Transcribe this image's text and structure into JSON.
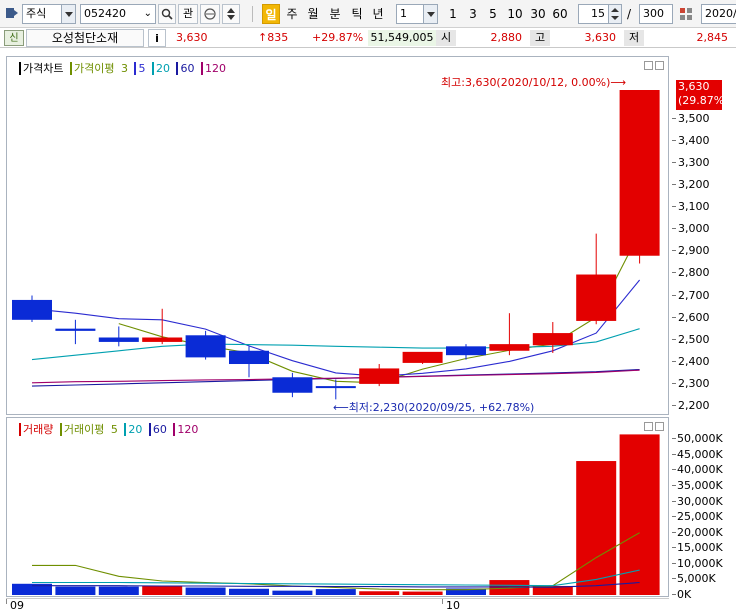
{
  "toolbar": {
    "market": "주식",
    "code": "052420",
    "btn_gwan": "관",
    "periods": [
      "일",
      "주",
      "월",
      "분",
      "틱",
      "년"
    ],
    "active_period": "일",
    "interval": "1",
    "quick_counts": [
      "1",
      "3",
      "5",
      "10",
      "30",
      "60"
    ],
    "count": "15",
    "separator": "/",
    "total": "300",
    "date": "2020/"
  },
  "info": {
    "badge": "신",
    "name": "오성첨단소재",
    "info_btn": "i",
    "price": "3,630",
    "change": "↑835",
    "change_pct": "+29.87%",
    "volume": "51,549,005",
    "open_label": "시",
    "open": "2,880",
    "high_label": "고",
    "high": "3,630",
    "low_label": "저",
    "low": "2,845"
  },
  "price_panel": {
    "legend_title": "가격차트",
    "legend_ma_label": "가격이평",
    "legend_ma": [
      "3",
      "5",
      "20",
      "60",
      "120"
    ],
    "max_annotation": "최고:3,630(2020/10/12, 0.00%)⟶",
    "min_annotation": "⟵최저:2,230(2020/09/25, +62.78%)",
    "current_price_tag": "3,630",
    "current_pct_tag": "(29.87%)"
  },
  "volume_panel": {
    "legend_title": "거래량",
    "legend_ma_label": "거래이평",
    "legend_ma": [
      "5",
      "20",
      "60",
      "120"
    ]
  },
  "x_axis": {
    "labels": [
      "09",
      "10"
    ]
  },
  "colors": {
    "up": "#e30000",
    "down": "#0a2bd6",
    "ma3": "#6f8f00",
    "ma5": "#2b2bd0",
    "ma20": "#00a0b0",
    "ma60": "#1a1aa0",
    "ma120": "#a0006a"
  },
  "chart_data": [
    {
      "type": "candlestick",
      "title": "가격차트",
      "ylim": [
        2200,
        3630
      ],
      "y_ticks": [
        "3,500",
        "3,400",
        "3,300",
        "3,200",
        "3,100",
        "3,000",
        "2,900",
        "2,800",
        "2,700",
        "2,600",
        "2,500",
        "2,400",
        "2,300",
        "2,200"
      ],
      "candles": [
        {
          "o": 2680,
          "h": 2700,
          "l": 2580,
          "c": 2590
        },
        {
          "o": 2550,
          "h": 2590,
          "l": 2480,
          "c": 2540
        },
        {
          "o": 2510,
          "h": 2560,
          "l": 2470,
          "c": 2490
        },
        {
          "o": 2490,
          "h": 2640,
          "l": 2480,
          "c": 2510
        },
        {
          "o": 2520,
          "h": 2540,
          "l": 2410,
          "c": 2420
        },
        {
          "o": 2450,
          "h": 2470,
          "l": 2330,
          "c": 2390
        },
        {
          "o": 2330,
          "h": 2350,
          "l": 2240,
          "c": 2260
        },
        {
          "o": 2290,
          "h": 2320,
          "l": 2230,
          "c": 2285
        },
        {
          "o": 2300,
          "h": 2390,
          "l": 2290,
          "c": 2370
        },
        {
          "o": 2395,
          "h": 2440,
          "l": 2390,
          "c": 2445
        },
        {
          "o": 2470,
          "h": 2480,
          "l": 2410,
          "c": 2430
        },
        {
          "o": 2450,
          "h": 2620,
          "l": 2430,
          "c": 2480
        },
        {
          "o": 2475,
          "h": 2580,
          "l": 2440,
          "c": 2530
        },
        {
          "o": 2585,
          "h": 2980,
          "l": 2570,
          "c": 2795
        },
        {
          "o": 2880,
          "h": 3630,
          "l": 2845,
          "c": 3630
        }
      ],
      "series": [
        {
          "name": "3",
          "values": [
            null,
            null,
            2573,
            2513,
            2473,
            2440,
            2357,
            2312,
            2305,
            2367,
            2415,
            2452,
            2480,
            2602,
            2985
          ]
        },
        {
          "name": "5",
          "values": [
            2640,
            2620,
            2595,
            2590,
            2548,
            2472,
            2405,
            2350,
            2335,
            2348,
            2368,
            2402,
            2450,
            2530,
            2770
          ]
        },
        {
          "name": "20",
          "values": [
            2410,
            2430,
            2450,
            2470,
            2480,
            2478,
            2475,
            2470,
            2466,
            2462,
            2462,
            2465,
            2470,
            2490,
            2550
          ]
        },
        {
          "name": "60",
          "values": [
            2290,
            2295,
            2300,
            2305,
            2310,
            2315,
            2320,
            2325,
            2330,
            2335,
            2340,
            2345,
            2350,
            2355,
            2365
          ]
        },
        {
          "name": "120",
          "values": [
            2305,
            2310,
            2312,
            2315,
            2318,
            2320,
            2323,
            2326,
            2330,
            2334,
            2338,
            2342,
            2346,
            2352,
            2362
          ]
        }
      ]
    },
    {
      "type": "bar",
      "title": "거래량",
      "ylim": [
        0,
        52000
      ],
      "y_ticks": [
        "50,000K",
        "45,000K",
        "40,000K",
        "35,000K",
        "30,000K",
        "25,000K",
        "20,000K",
        "15,000K",
        "10,000K",
        "5,000K",
        "0K"
      ],
      "values": [
        3600,
        2700,
        2700,
        3000,
        2400,
        2000,
        1400,
        1900,
        1200,
        1100,
        2100,
        4800,
        2900,
        43000,
        51549
      ],
      "up": [
        false,
        false,
        false,
        true,
        false,
        false,
        false,
        false,
        true,
        true,
        false,
        true,
        true,
        true,
        true
      ],
      "series": [
        {
          "name": "5",
          "values": [
            9500,
            9500,
            6000,
            4500,
            4000,
            3600,
            2900,
            2400,
            1900,
            1700,
            1700,
            2200,
            3000,
            12000,
            20000
          ]
        },
        {
          "name": "20",
          "values": [
            4000,
            4000,
            4000,
            3900,
            3800,
            3700,
            3600,
            3500,
            3400,
            3300,
            3200,
            3100,
            3000,
            5000,
            8000
          ]
        },
        {
          "name": "60",
          "values": [
            3000,
            3000,
            3000,
            2900,
            2900,
            2800,
            2800,
            2700,
            2700,
            2600,
            2600,
            2600,
            2500,
            3000,
            4000
          ]
        }
      ]
    }
  ]
}
